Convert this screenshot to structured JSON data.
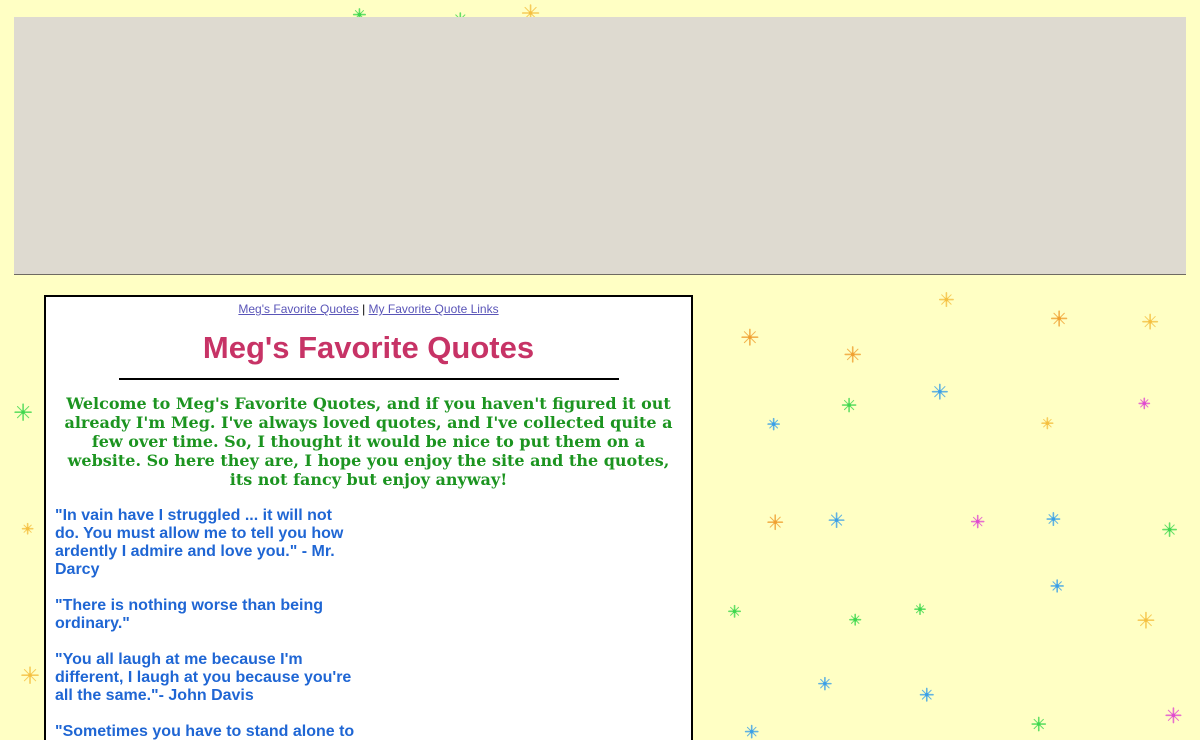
{
  "nav": {
    "link_home": "Meg's Favorite Quotes",
    "separator": "|",
    "link_links": "My Favorite Quote Links"
  },
  "title": "Meg's Favorite Quotes",
  "welcome": "Welcome to Meg's Favorite Quotes, and if you haven't figured it out already I'm Meg. I've always loved quotes, and I've collected quite a few over time. So, I thought it would be nice to put them on a website. So here they are, I hope you enjoy the site and the quotes, its not fancy but enjoy anyway!",
  "quotes": [
    "\"In vain have I struggled ... it will not do. You must allow me to tell you how ardently I admire and love you.\" - Mr. Darcy",
    "\"There is nothing worse than being ordinary.\"",
    "\"You all laugh at me because I'm different, I laugh at you because you're all the same.\"- John Davis",
    "\"Sometimes you have to stand alone to prove that you can stand.\""
  ],
  "colors": {
    "background": "#ffffc4",
    "title": "#c73366",
    "welcome_text": "#1c9420",
    "quote_text": "#1f66d4",
    "link": "#5a55b8",
    "banner": "#dedad0"
  }
}
